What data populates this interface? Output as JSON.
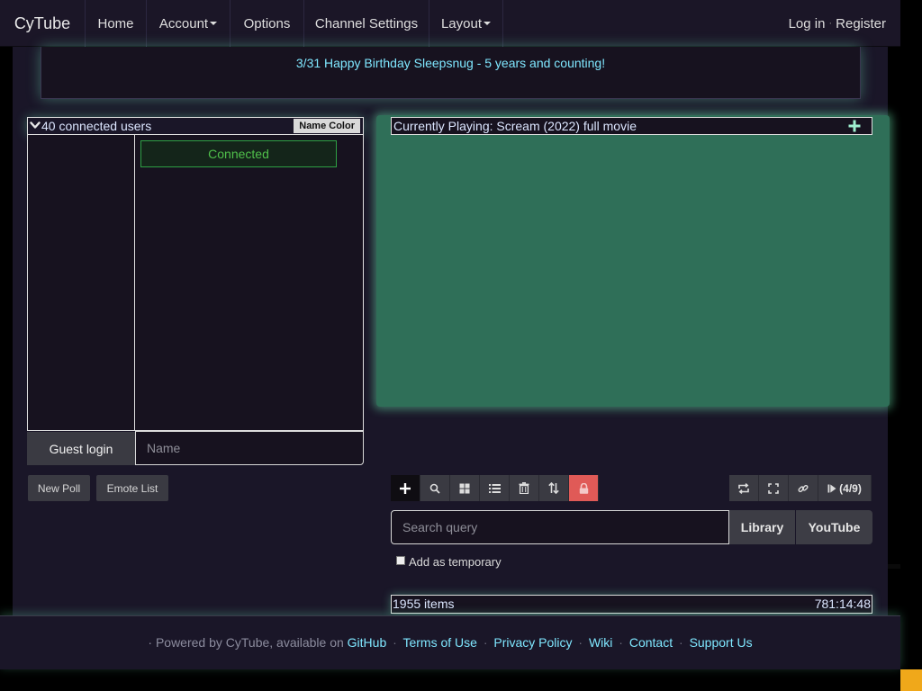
{
  "navbar": {
    "brand": "CyTube",
    "items": [
      {
        "label": "Home"
      },
      {
        "label": "Account"
      },
      {
        "label": "Options"
      },
      {
        "label": "Channel Settings"
      },
      {
        "label": "Layout"
      }
    ],
    "login": "Log in",
    "separator": "·",
    "register": "Register"
  },
  "motd": {
    "text": "3/31 Happy Birthday Sleepsnug - 5 years and counting!"
  },
  "chat": {
    "user_count": "40 connected users",
    "name_color_button": "Name Color",
    "status": "Connected",
    "guest_login_button": "Guest login",
    "name_placeholder": "Name"
  },
  "poll_buttons": {
    "new_poll": "New Poll",
    "emote_list": "Emote List"
  },
  "video": {
    "now_playing": "Currently Playing: Scream (2022) full movie"
  },
  "playlist": {
    "controls": [
      "add-icon",
      "search-icon",
      "grid-icon",
      "list-icon",
      "trash-icon",
      "sort-icon",
      "lock-icon"
    ],
    "right_controls": [
      "repeat-icon",
      "fullscreen-icon",
      "link-icon",
      "skip-icon"
    ],
    "skip_label": "(4/9)",
    "search_placeholder": "Search query",
    "library_button": "Library",
    "youtube_button": "YouTube",
    "add_temporary": "Add as temporary",
    "item_count": "1955 items",
    "total_time": "781:14:48"
  },
  "footer": {
    "prefix": "· Powered by CyTube, available on",
    "links": [
      "GitHub",
      "Terms of Use",
      "Privacy Policy",
      "Wiki",
      "Contact",
      "Support Us"
    ],
    "separator": "·"
  },
  "colors": {
    "background": "#1a1628",
    "accent_cyan": "#7fe7ff",
    "video_green": "#2f6f58",
    "lock_red": "#e05a57",
    "connected_green": "#4fbf4a",
    "corner_orange": "#f0a81a"
  }
}
